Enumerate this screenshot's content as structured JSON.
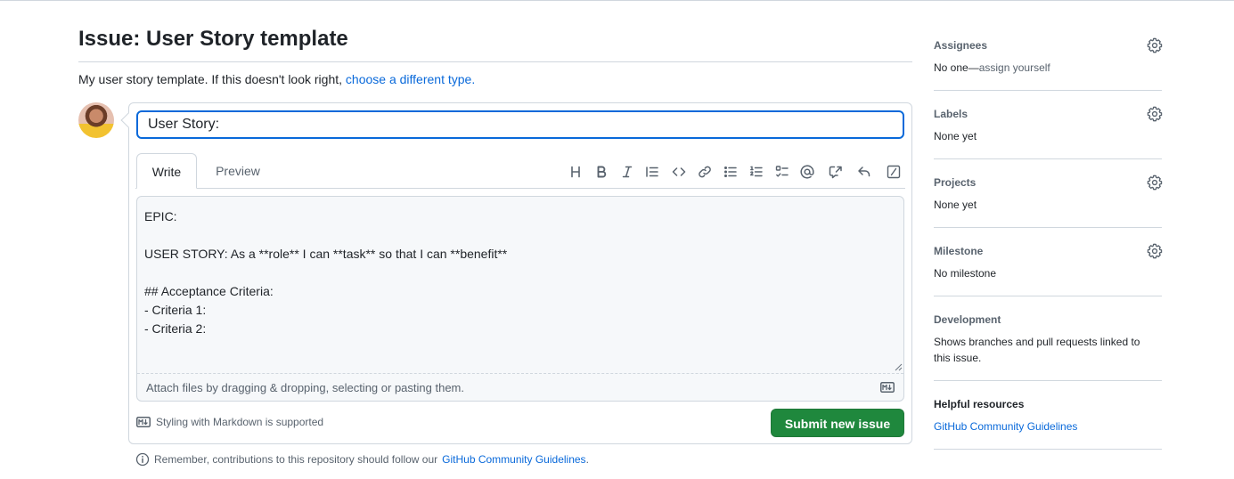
{
  "issue": {
    "title": "Issue: User Story template",
    "template_note": "My user story template. If this doesn't look right,",
    "template_link": "choose a different type."
  },
  "composer": {
    "title_value": "User Story:",
    "tabs": {
      "write": "Write",
      "preview": "Preview"
    },
    "toolbar_icons": [
      "heading-icon",
      "bold-icon",
      "italic-icon",
      "quote-icon",
      "code-icon",
      "link-icon",
      "bulleted-list-icon",
      "numbered-list-icon",
      "task-list-icon",
      "mention-icon",
      "cross-reference-icon",
      "reply-icon",
      "slash-command-icon"
    ],
    "body_text": "EPIC:\n\nUSER STORY: As a **role** I can **task** so that I can **benefit**\n\n## Acceptance Criteria:\n- Criteria 1:\n- Criteria 2:",
    "attach_hint": "Attach files by dragging & dropping, selecting or pasting them.",
    "markdown_note": "Styling with Markdown is supported",
    "submit_label": "Submit new issue",
    "remember_text": "Remember, contributions to this repository should follow our",
    "remember_link": "GitHub Community Guidelines",
    "remember_end": "."
  },
  "sidebar": {
    "assignees": {
      "heading": "Assignees",
      "value_prefix": "No one—",
      "value_link": "assign yourself"
    },
    "labels": {
      "heading": "Labels",
      "value": "None yet"
    },
    "projects": {
      "heading": "Projects",
      "value": "None yet"
    },
    "milestone": {
      "heading": "Milestone",
      "value": "No milestone"
    },
    "development": {
      "heading": "Development",
      "value_line1": "Shows branches and pull requests linked to",
      "value_line2": "this issue."
    },
    "helpful": {
      "heading": "Helpful resources",
      "link": "GitHub Community Guidelines"
    }
  },
  "colors": {
    "accent": "#0969da",
    "submit": "#1f883d",
    "border": "#d0d7de",
    "muted": "#59636e"
  }
}
